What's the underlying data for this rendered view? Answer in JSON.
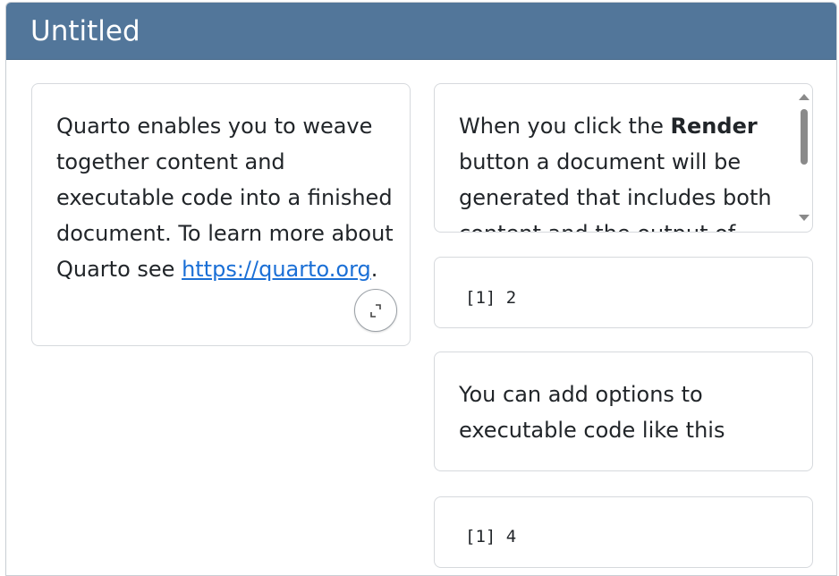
{
  "window": {
    "title": "Untitled"
  },
  "left_column": {
    "card1": {
      "text_before_link": "Quarto enables you to weave together content and executable code into a finished document. To learn more about Quarto see ",
      "link_text": "https://quarto.org",
      "text_after_link": ".",
      "expand_button_icon": "expand-icon"
    }
  },
  "right_column": {
    "card_render": {
      "text_before_bold": "When you click the ",
      "bold_text": "Render",
      "text_after_bold": " button a document will be generated that includes both content and the output of embedded code."
    },
    "output1": {
      "text": "[1] 2"
    },
    "card_options": {
      "text": "You can add options to executable code like this"
    },
    "output2": {
      "text": "[1] 4"
    }
  },
  "colors": {
    "titlebar": "#52769a",
    "link": "#1a6fd6",
    "text": "#212529",
    "border": "#d6d9dd"
  }
}
